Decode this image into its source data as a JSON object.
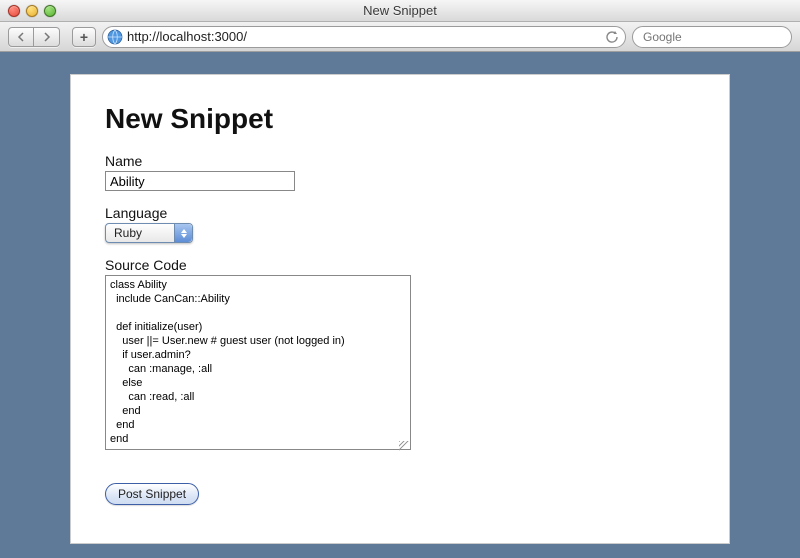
{
  "window": {
    "title": "New Snippet"
  },
  "toolbar": {
    "url": "http://localhost:3000/",
    "search_placeholder": "Google"
  },
  "page": {
    "heading": "New Snippet",
    "name": {
      "label": "Name",
      "value": "Ability"
    },
    "language": {
      "label": "Language",
      "value": "Ruby"
    },
    "source": {
      "label": "Source Code",
      "value": "class Ability\n  include CanCan::Ability\n\n  def initialize(user)\n    user ||= User.new # guest user (not logged in)\n    if user.admin?\n      can :manage, :all\n    else\n      can :read, :all\n    end\n  end\nend"
    },
    "submit_label": "Post Snippet"
  }
}
